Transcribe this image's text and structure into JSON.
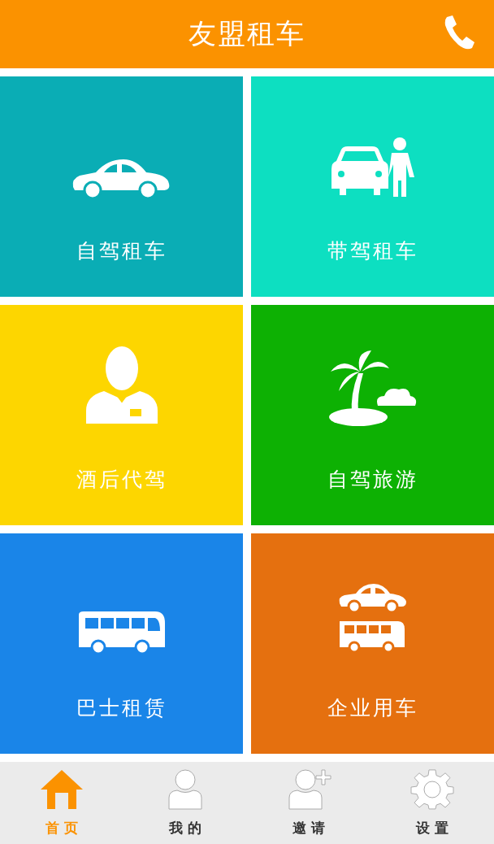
{
  "header": {
    "title": "友盟租车"
  },
  "tiles": [
    {
      "label": "自驾租车",
      "kind": "car",
      "color": "#0aadb5"
    },
    {
      "label": "带驾租车",
      "kind": "driver",
      "color": "#0ddfc1"
    },
    {
      "label": "酒后代驾",
      "kind": "chauffeur",
      "color": "#fdd600"
    },
    {
      "label": "自驾旅游",
      "kind": "travel",
      "color": "#0db103"
    },
    {
      "label": "巴士租赁",
      "kind": "bus",
      "color": "#1a85e8"
    },
    {
      "label": "企业用车",
      "kind": "fleet",
      "color": "#e5700f"
    }
  ],
  "nav": [
    {
      "label": "首 页",
      "kind": "home",
      "selected": true
    },
    {
      "label": "我 的",
      "kind": "user",
      "selected": false
    },
    {
      "label": "邀 请",
      "kind": "invite",
      "selected": false
    },
    {
      "label": "设 置",
      "kind": "settings",
      "selected": false
    }
  ]
}
